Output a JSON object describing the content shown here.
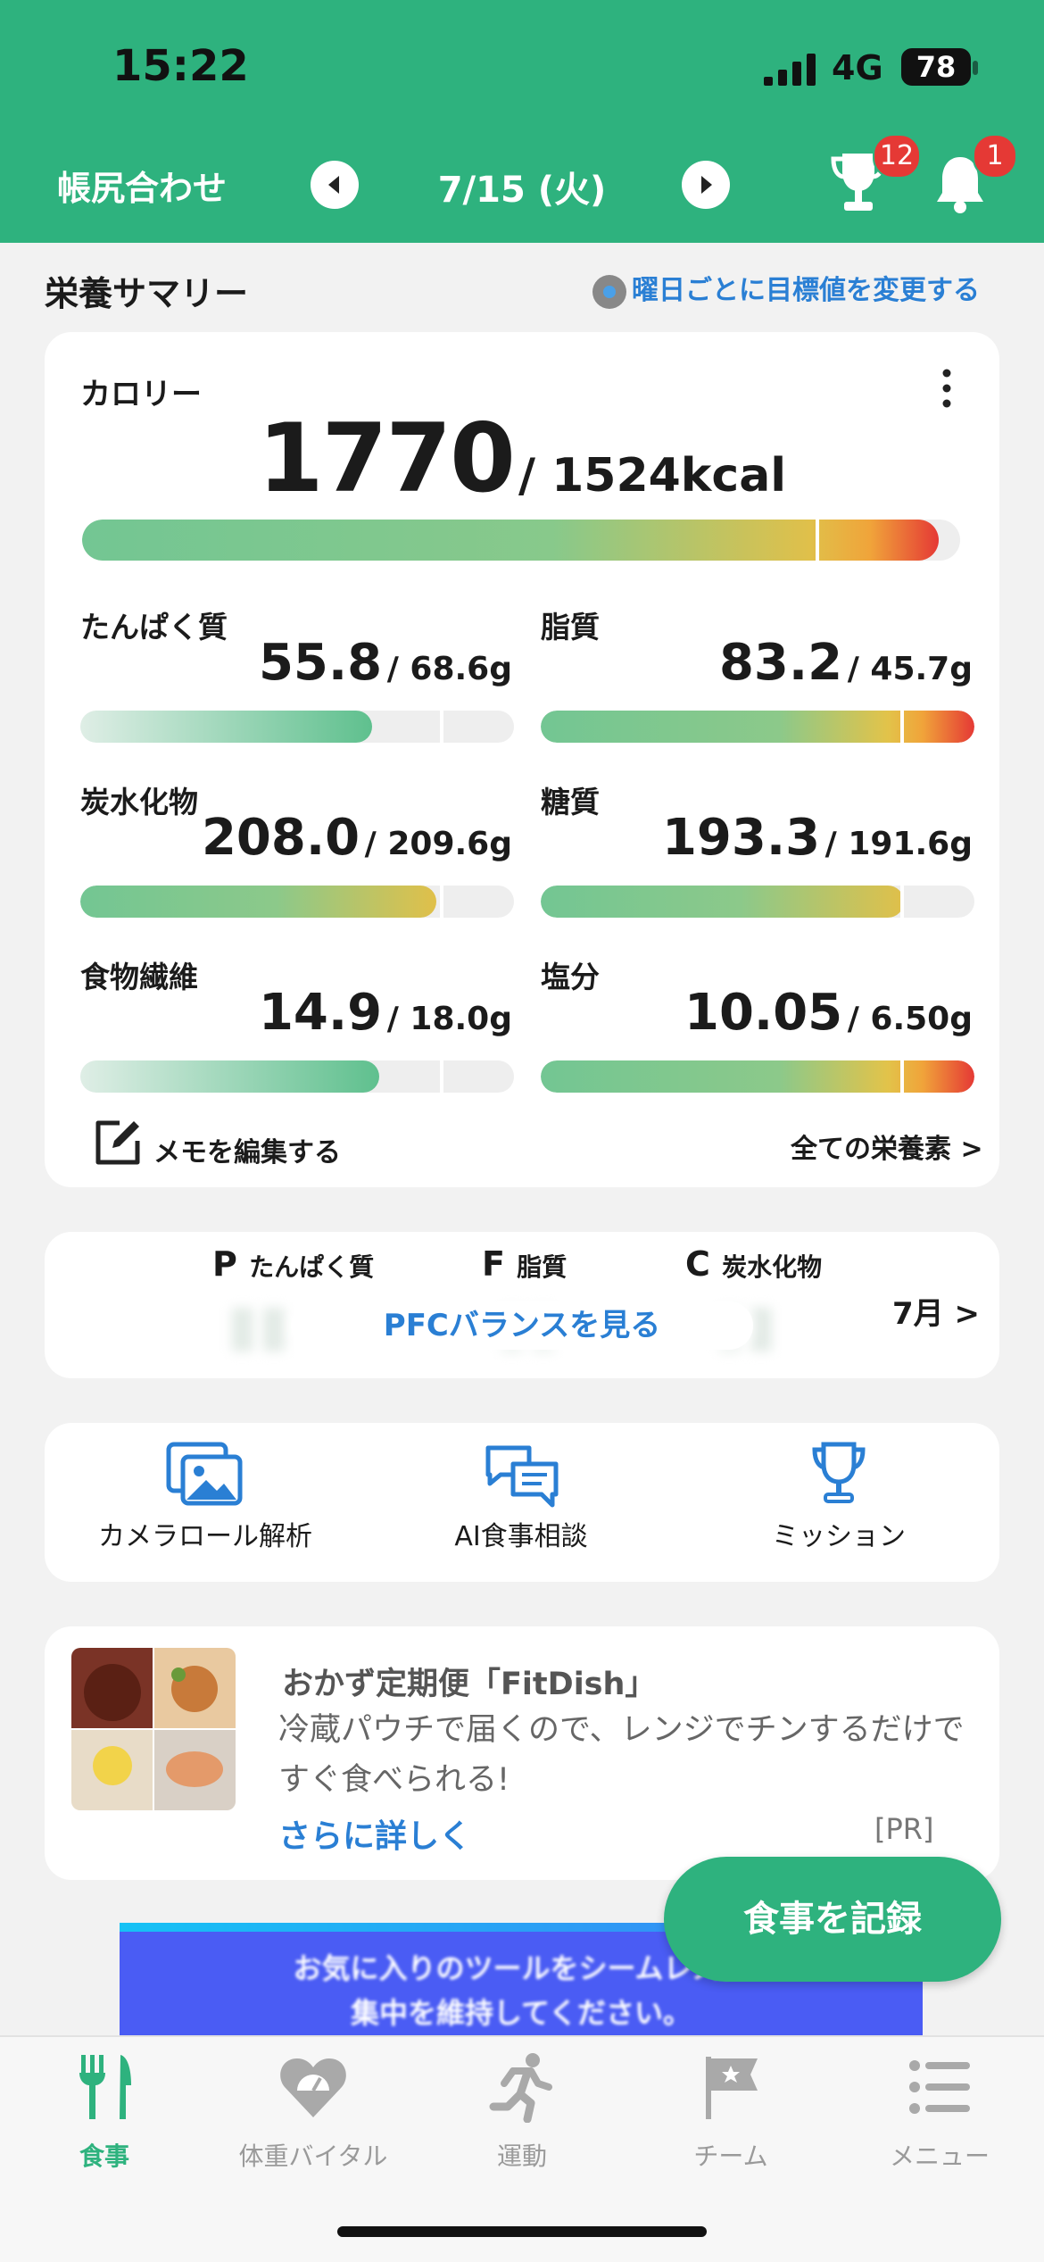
{
  "status_bar": {
    "time": "15:22",
    "network": "4G",
    "battery": "78"
  },
  "header": {
    "title": "帳尻合わせ",
    "date": "7/15 (火)",
    "trophy_badge": "12",
    "bell_badge": "1"
  },
  "summary": {
    "title": "栄養サマリー",
    "goal_link": "曜日ごとに目標値を変更する"
  },
  "calorie": {
    "label": "カロリー",
    "value": "1770",
    "goal": "/ 1524kcal",
    "progress": 1.161
  },
  "nutrients": [
    {
      "label": "たんぱく質",
      "value": "55.8",
      "goal": "/ 68.6g",
      "progress": 0.81
    },
    {
      "label": "脂質",
      "value": "83.2",
      "goal": "/ 45.7g",
      "progress": 1.82
    },
    {
      "label": "炭水化物",
      "value": "208.0",
      "goal": "/ 209.6g",
      "progress": 0.99
    },
    {
      "label": "糖質",
      "value": "193.3",
      "goal": "/ 191.6g",
      "progress": 1.01
    },
    {
      "label": "食物繊維",
      "value": "14.9",
      "goal": "/ 18.0g",
      "progress": 0.83
    },
    {
      "label": "塩分",
      "value": "10.05",
      "goal": "/ 6.50g",
      "progress": 1.55
    }
  ],
  "memo": {
    "label": "メモを編集する"
  },
  "all_nutrients": {
    "label": "全ての栄養素 >"
  },
  "pfc": {
    "p_letter": "P",
    "p_label": "たんぱく質",
    "f_letter": "F",
    "f_label": "脂質",
    "c_letter": "C",
    "c_label": "炭水化物",
    "button": "PFCバランスを見る",
    "month_link": "7月 >"
  },
  "tools": [
    {
      "label": "カメラロール解析",
      "icon": "photos-icon"
    },
    {
      "label": "AI食事相談",
      "icon": "chat-icon"
    },
    {
      "label": "ミッション",
      "icon": "trophy-icon"
    }
  ],
  "ad": {
    "title": "おかず定期便「FitDish」",
    "description": "冷蔵パウチで届くので、レンジでチンするだけですぐ食べられる!",
    "more": "さらに詳しく",
    "pr": "[PR]"
  },
  "banner": {
    "line1": "お気に入りのツールをシームレスに",
    "line2": "集中を維持してください。"
  },
  "fab": {
    "label": "食事を記録"
  },
  "tabs": [
    {
      "label": "食事",
      "icon": "fork-knife-icon",
      "active": true
    },
    {
      "label": "体重バイタル",
      "icon": "heart-scale-icon",
      "active": false
    },
    {
      "label": "運動",
      "icon": "runner-icon",
      "active": false
    },
    {
      "label": "チーム",
      "icon": "flag-icon",
      "active": false
    },
    {
      "label": "メニュー",
      "icon": "menu-icon",
      "active": false
    }
  ],
  "colors": {
    "brand": "#2eb27e",
    "link": "#2a7fd4",
    "badge": "#e53935"
  }
}
